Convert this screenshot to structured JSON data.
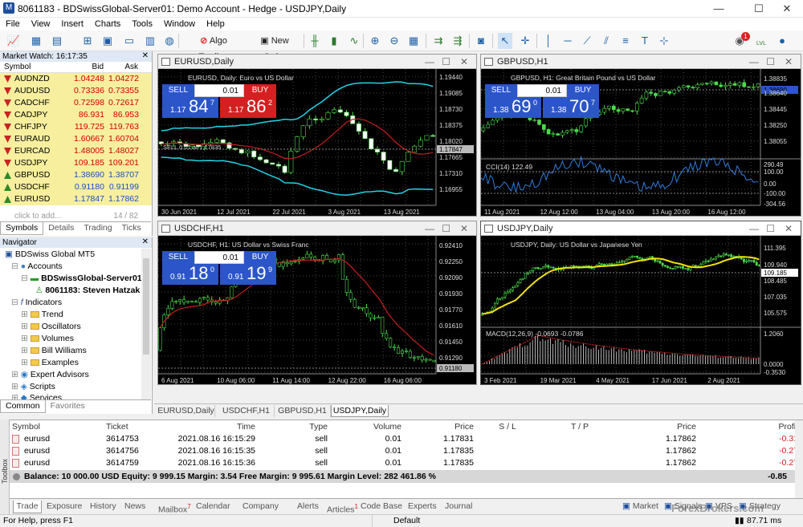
{
  "window": {
    "title": "8061183 - BDSwissGlobal-Server01: Demo Account - Hedge - USDJPY,Daily"
  },
  "menu": [
    "File",
    "View",
    "Insert",
    "Charts",
    "Tools",
    "Window",
    "Help"
  ],
  "toolbar": {
    "algo": "Algo Trading",
    "neworder": "New Order",
    "notif": "1",
    "lvl": "LVL"
  },
  "market_watch": {
    "header": "Market Watch: 16:17:35",
    "cols": {
      "symbol": "Symbol",
      "bid": "Bid",
      "ask": "Ask"
    },
    "rows": [
      {
        "symbol": "AUDNZD",
        "bid": "1.04248",
        "ask": "1.04272",
        "dir": "down"
      },
      {
        "symbol": "AUDUSD",
        "bid": "0.73336",
        "ask": "0.73355",
        "dir": "down"
      },
      {
        "symbol": "CADCHF",
        "bid": "0.72598",
        "ask": "0.72617",
        "dir": "down"
      },
      {
        "symbol": "CADJPY",
        "bid": "86.931",
        "ask": "86.953",
        "dir": "down"
      },
      {
        "symbol": "CHFJPY",
        "bid": "119.725",
        "ask": "119.763",
        "dir": "down"
      },
      {
        "symbol": "EURAUD",
        "bid": "1.60667",
        "ask": "1.60704",
        "dir": "down"
      },
      {
        "symbol": "EURCAD",
        "bid": "1.48005",
        "ask": "1.48027",
        "dir": "down"
      },
      {
        "symbol": "USDJPY",
        "bid": "109.185",
        "ask": "109.201",
        "dir": "down"
      },
      {
        "symbol": "GBPUSD",
        "bid": "1.38690",
        "ask": "1.38707",
        "dir": "up"
      },
      {
        "symbol": "USDCHF",
        "bid": "0.91180",
        "ask": "0.91199",
        "dir": "up"
      },
      {
        "symbol": "EURUSD",
        "bid": "1.17847",
        "ask": "1.17862",
        "dir": "up"
      }
    ],
    "add": "click to add...",
    "count": "14 / 82",
    "tabs": [
      "Symbols",
      "Details",
      "Trading",
      "Ticks"
    ]
  },
  "navigator": {
    "header": "Navigator",
    "root": "BDSwiss Global MT5",
    "accounts": "Accounts",
    "server": "BDSwissGlobal-Server01",
    "account": "8061183: Steven Hatzak",
    "indicators": "Indicators",
    "folders": [
      "Trend",
      "Oscillators",
      "Volumes",
      "Bill Williams",
      "Examples"
    ],
    "experts": "Expert Advisors",
    "scripts": "Scripts",
    "services": "Services",
    "tabs": [
      "Common",
      "Favorites"
    ]
  },
  "charts": {
    "eurusd": {
      "title": "EURUSD,Daily",
      "ctitle": "EURUSD, Daily:  Euro vs US Dollar",
      "sell_int": "1.17",
      "sell_big": "84",
      "sell_sup": "7",
      "buy_int": "1.17",
      "buy_big": "86",
      "buy_sup": "2",
      "vol": "0.01",
      "prices": [
        "1.19440",
        "1.19085",
        "1.18730",
        "1.18375",
        "1.18020",
        "1.17847",
        "1.17665",
        "1.17310",
        "1.16955"
      ],
      "dates": [
        "30 Jun 2021",
        "12 Jul 2021",
        "22 Jul 2021",
        "3 Aug 2021",
        "13 Aug 2021"
      ],
      "sellline": "SELL 0.01 at 1.17835"
    },
    "gbpusd": {
      "title": "GBPUSD,H1",
      "ctitle": "GBPUSD, H1:  Great Britain Pound vs US Dollar",
      "sell_int": "1.38",
      "sell_big": "69",
      "sell_sup": "0",
      "buy_int": "1.38",
      "buy_big": "70",
      "buy_sup": "7",
      "vol": "0.01",
      "prices": [
        "1.38835",
        "1.38690",
        "1.38640",
        "1.38445",
        "1.38250",
        "1.38055"
      ],
      "cci_prices": [
        "290.49",
        "100.00",
        "0.00",
        "-100.00",
        "-304.56"
      ],
      "cci": "CCI(14) 122.49",
      "dates": [
        "11 Aug 2021",
        "12 Aug 12:00",
        "13 Aug 04:00",
        "13 Aug 20:00",
        "16 Aug 12:00"
      ]
    },
    "usdchf": {
      "title": "USDCHF,H1",
      "ctitle": "USDCHF, H1:  US Dollar vs Swiss Franc",
      "sell_int": "0.91",
      "sell_big": "18",
      "sell_sup": "0",
      "buy_int": "0.91",
      "buy_big": "19",
      "buy_sup": "9",
      "vol": "0.01",
      "prices": [
        "0.92410",
        "0.92250",
        "0.92090",
        "0.91930",
        "0.91770",
        "0.91610",
        "0.91450",
        "0.91290",
        "0.91180"
      ],
      "dates": [
        "6 Aug 2021",
        "10 Aug 06:00",
        "11 Aug 14:00",
        "12 Aug 22:00",
        "16 Aug 06:00"
      ]
    },
    "usdjpy": {
      "title": "USDJPY,Daily",
      "ctitle": "USDJPY, Daily:  US Dollar vs Japanese Yen",
      "prices": [
        "111.395",
        "109.940",
        "109.185",
        "108.485",
        "107.035",
        "105.575"
      ],
      "macd_prices": [
        "1.2060",
        "0.0000",
        "-0.3530"
      ],
      "macd": "MACD(12,26,9) -0.0693 -0.0786",
      "dates": [
        "3 Feb 2021",
        "19 Mar 2021",
        "4 May 2021",
        "17 Jun 2021",
        "2 Aug 2021"
      ]
    }
  },
  "chart_tabs": [
    "EURUSD,Daily",
    "USDCHF,H1",
    "GBPUSD,H1",
    "USDJPY,Daily"
  ],
  "trade": {
    "cols": [
      "Symbol",
      "Ticket",
      "Time",
      "Type",
      "Volume",
      "Price",
      "S / L",
      "T / P",
      "Price",
      "Profit"
    ],
    "rows": [
      {
        "symbol": "eurusd",
        "ticket": "3614753",
        "time": "2021.08.16 16:15:29",
        "type": "sell",
        "volume": "0.01",
        "price": "1.17831",
        "cur": "1.17862",
        "profit": "-0.31"
      },
      {
        "symbol": "eurusd",
        "ticket": "3614756",
        "time": "2021.08.16 16:15:35",
        "type": "sell",
        "volume": "0.01",
        "price": "1.17835",
        "cur": "1.17862",
        "profit": "-0.27"
      },
      {
        "symbol": "eurusd",
        "ticket": "3614759",
        "time": "2021.08.16 16:15:36",
        "type": "sell",
        "volume": "0.01",
        "price": "1.17835",
        "cur": "1.17862",
        "profit": "-0.27"
      }
    ],
    "balance": "Balance: 10 000.00 USD  Equity: 9 999.15  Margin: 3.54  Free Margin: 9 995.61  Margin Level: 282 461.86 %",
    "total": "-0.85"
  },
  "toolbox": {
    "label": "Toolbox",
    "tabs": [
      "Trade",
      "Exposure",
      "History",
      "News",
      "Mailbox",
      "Calendar",
      "Company",
      "Alerts",
      "Articles",
      "Code Base",
      "Experts",
      "Journal"
    ],
    "mail_badge": "7",
    "articles_badge": "1",
    "right": [
      "Market",
      "Signals",
      "VPS",
      "Strategy Tester"
    ]
  },
  "status": {
    "help": "For Help, press F1",
    "profile": "Default",
    "ping": "87.71 ms"
  },
  "watermark": "ForexBrokers.com"
}
